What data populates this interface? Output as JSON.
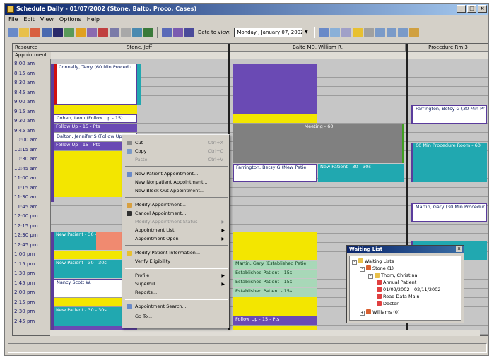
{
  "window": {
    "title": "Schedule Daily - 01/07/2002 (Stone, Balto, Proco, Cases)"
  },
  "menu": [
    "File",
    "Edit",
    "View",
    "Options",
    "Help"
  ],
  "toolbar": {
    "date_label": "Date to view:",
    "date_value": "Monday , January 07, 2002"
  },
  "header": {
    "resource_label": "Resource",
    "appointment_label": "Appointment"
  },
  "providers": [
    "Stone, Jeff",
    "Balto MD, William R.",
    "Procedure Rm 3"
  ],
  "times": [
    "8:00 am",
    "8:15 am",
    "8:30 am",
    "8:45 am",
    "9:00 am",
    "9:15 am",
    "9:30 am",
    "9:45 am",
    "10:00 am",
    "10:15 am",
    "10:30 am",
    "10:45 am",
    "11:00 am",
    "11:15 am",
    "11:30 am",
    "11:45 am",
    "12:00 pm",
    "12:15 pm",
    "12:30 pm",
    "12:45 pm",
    "1:00 pm",
    "1:15 pm",
    "1:30 pm",
    "1:45 pm",
    "2:00 pm",
    "2:15 pm",
    "2:30 pm",
    "2:45 pm"
  ],
  "appointments": {
    "stone": [
      "Connelly, Terry (60 Min Procedu",
      "Cohen, Leon (Follow Up - 15)",
      "Follow Up - 15 - Pts",
      "Dalton, Jennifer S (Follow Up",
      "Follow Up - 15 - Pts",
      "New Patient - 30 - 30 (Resea",
      "New Patient - 30 - 30s",
      "Nancy Scott W.",
      "New Patient - 30 - 30s"
    ],
    "balto": [
      "Meeting - 60",
      "Farrington, Betsy G (New Patie",
      "New Patient - 30 - 30s",
      "Martin, Gary (Established Patie",
      "Established Patient - 15s",
      "Established Patient - 15s",
      "Established Patient - 15s",
      "Follow Up - 15 - Pts"
    ],
    "procedure": [
      "Farrington, Betsy G (30 Min Pr",
      "60 Min Procedure Room - 60",
      "Martin, Gary (30 Min Procedur"
    ]
  },
  "context_menu": {
    "cut": "Cut",
    "cut_key": "Ctrl+X",
    "copy": "Copy",
    "copy_key": "Ctrl+C",
    "paste": "Paste",
    "paste_key": "Ctrl+V",
    "new_patient": "New Patient Appointment...",
    "new_nonpatient": "New Nonpatient Appointment...",
    "new_block": "New Block Out Appointment...",
    "modify": "Modify Appointment...",
    "cancel": "Cancel Appointment...",
    "modify_status": "Modify Appointment Status",
    "appointment_list": "Appointment List",
    "appointment_open": "Appointment Open",
    "modify_patient": "Modify Patient Information...",
    "verify": "Verify Eligibility",
    "profile": "Profile",
    "superbill": "Superbill",
    "reports": "Reports...",
    "search": "Appointment Search...",
    "goto": "Go To..."
  },
  "waiting_list": {
    "title": "Waiting List",
    "items": [
      "Waiting Lists",
      "Stone (1)",
      "Thom, Christina",
      "Annual Patient",
      "01/09/2002 - 02/11/2002",
      "Road Data Main",
      "Doctor",
      "Williams (0)"
    ]
  }
}
